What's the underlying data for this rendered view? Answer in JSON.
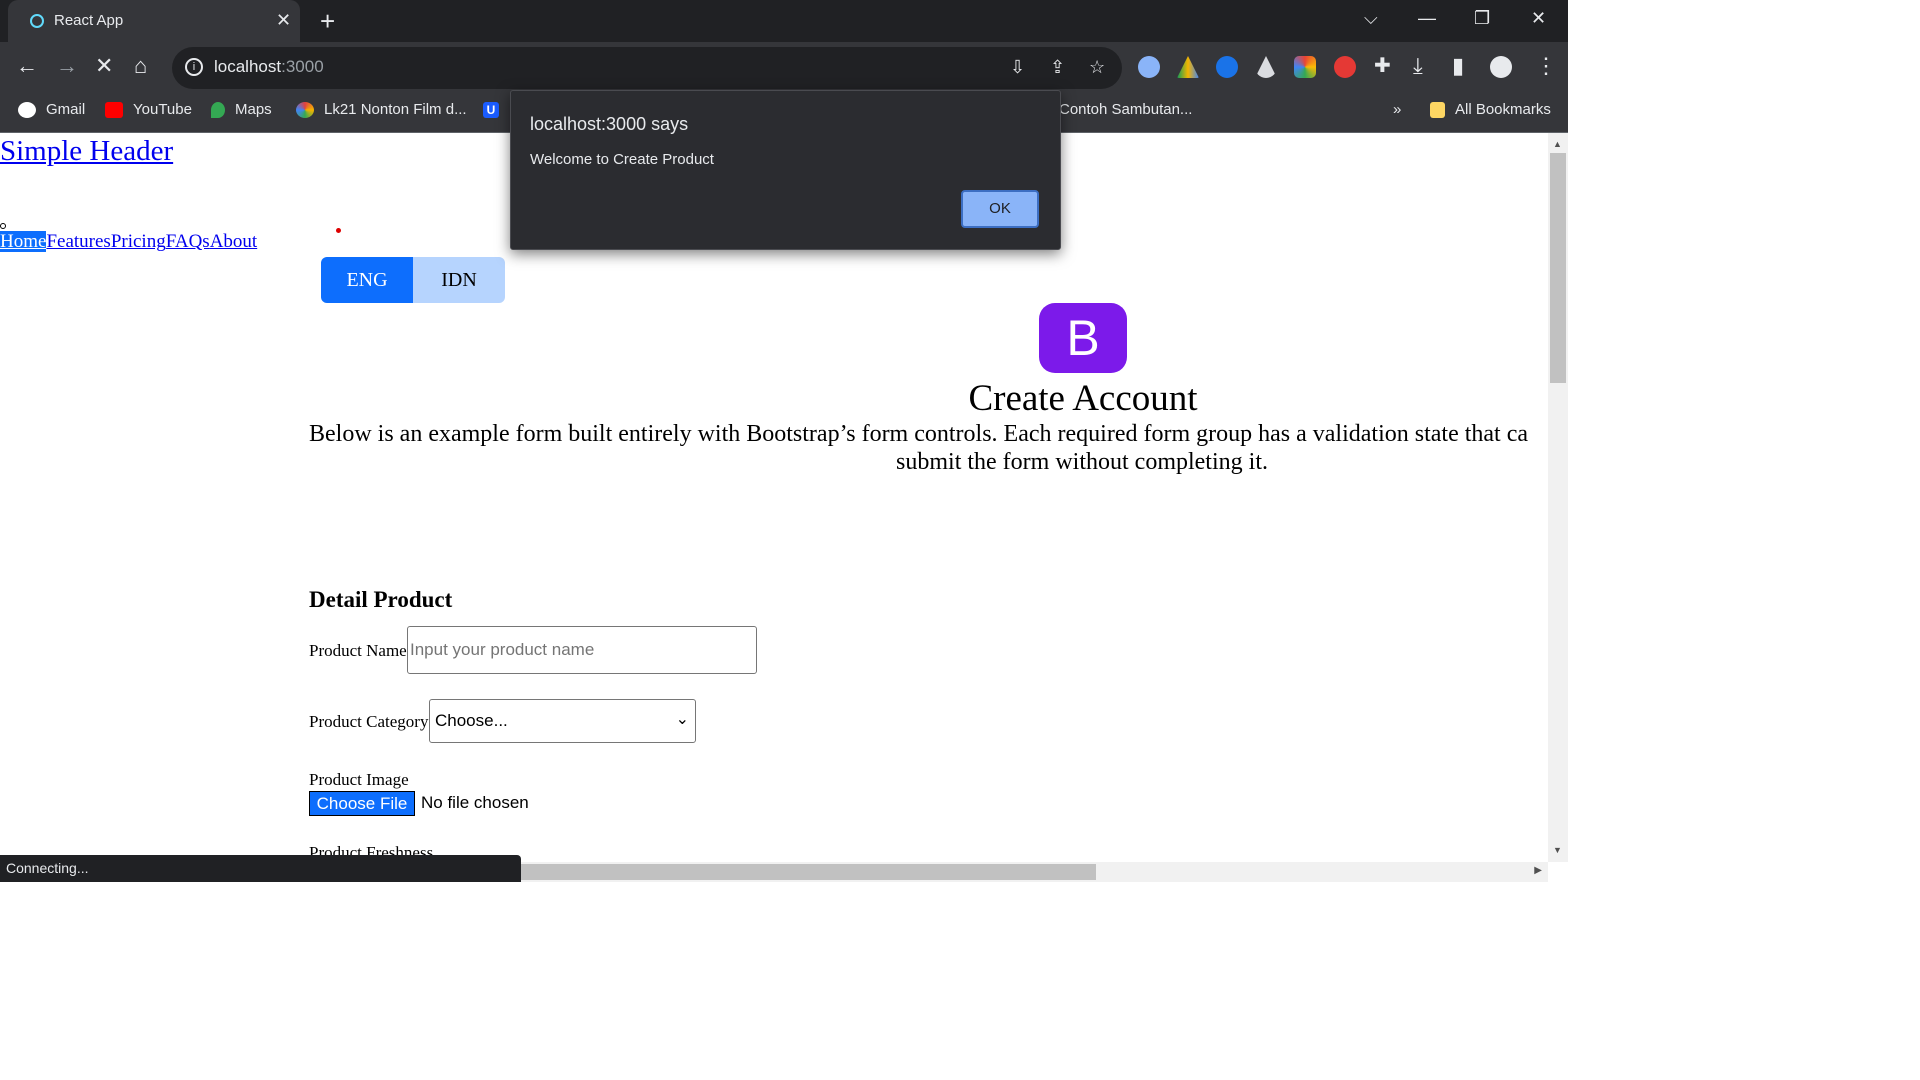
{
  "browser": {
    "tab_title": "React App",
    "url_host": "localhost",
    "url_port": ":3000",
    "bookmarks": [
      {
        "label": "Gmail",
        "icon": "google-icon",
        "color": "#4285f4"
      },
      {
        "label": "YouTube",
        "icon": "youtube-icon",
        "color": "#ff0000"
      },
      {
        "label": "Maps",
        "icon": "maps-icon",
        "color": "#34a853"
      },
      {
        "label": "Lk21 Nonton Film d...",
        "icon": "pinwheel-icon",
        "color": "#e04040"
      },
      {
        "label": "",
        "icon": "u-icon",
        "color": "#1a5cff"
      },
      {
        "label": "Contoh Sambutan...",
        "icon": "",
        "color": ""
      }
    ],
    "bookmarks_overflow": "»",
    "all_bookmarks": "All Bookmarks",
    "status_text": "Connecting..."
  },
  "dialog": {
    "title": "localhost:3000 says",
    "message": "Welcome to Create Product",
    "ok_label": "OK"
  },
  "page": {
    "header_title": "Simple Header",
    "nav": [
      "Home",
      "Features",
      "Pricing",
      "FAQs",
      "About"
    ],
    "lang": [
      "ENG",
      "IDN"
    ],
    "logo_letter": "B",
    "heading": "Create Account",
    "lead_line1": "Below is an example form built entirely with Bootstrap’s form controls. Each required form group has a validation state that ca",
    "lead_line2": "submit the form without completing it.",
    "section_title": "Detail Product",
    "product_name_label": "Product Name",
    "product_name_placeholder": "Input your product name",
    "product_category_label": "Product Category",
    "product_category_value": "Choose...",
    "product_image_label": "Product Image",
    "choose_file_label": "Choose File",
    "no_file_label": "No file chosen",
    "product_freshness_label": "Product Freshness"
  },
  "colors": {
    "primary": "#0d6efd",
    "primary_light": "#b6d4fe",
    "bootstrap_purple": "#7c1aea",
    "link": "#0000ee"
  }
}
